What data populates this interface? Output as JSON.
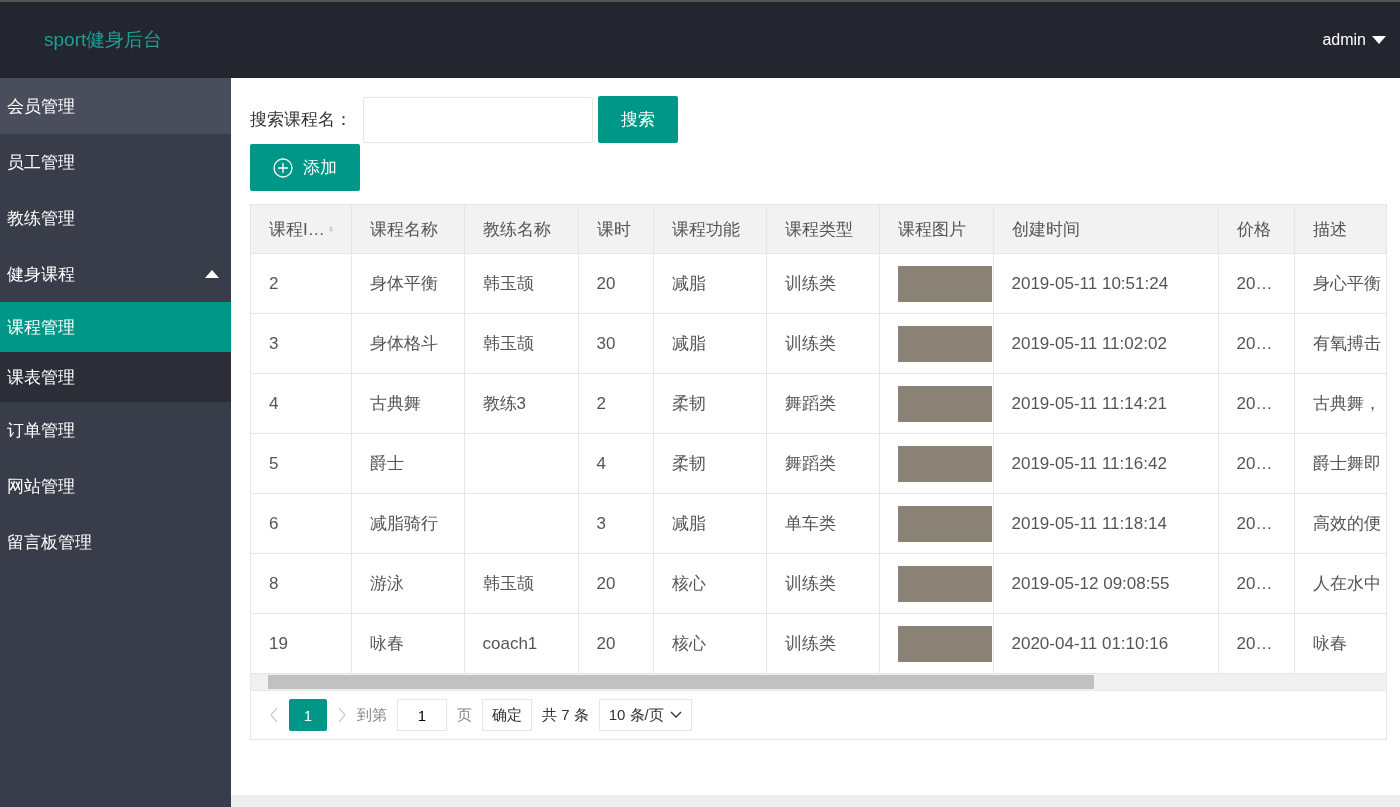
{
  "header": {
    "title": "sport健身后台",
    "user": "admin"
  },
  "sidebar": {
    "items": [
      {
        "label": "会员管理",
        "selected": false,
        "hovered": true
      },
      {
        "label": "员工管理",
        "selected": false,
        "hovered": false
      },
      {
        "label": "教练管理",
        "selected": false,
        "hovered": false
      },
      {
        "label": "健身课程",
        "selected": false,
        "hovered": false,
        "expanded": true,
        "children": [
          {
            "label": "课程管理",
            "selected": true
          },
          {
            "label": "课表管理",
            "selected": false
          }
        ]
      },
      {
        "label": "订单管理",
        "selected": false,
        "hovered": false
      },
      {
        "label": "网站管理",
        "selected": false,
        "hovered": false
      },
      {
        "label": "留言板管理",
        "selected": false,
        "hovered": false
      }
    ]
  },
  "search": {
    "label": "搜索课程名：",
    "button": "搜索"
  },
  "add_button": "添加",
  "table": {
    "columns": [
      {
        "label": "课程I…",
        "kind": "text",
        "sortable": true
      },
      {
        "label": "课程名称",
        "kind": "text"
      },
      {
        "label": "教练名称",
        "kind": "text"
      },
      {
        "label": "课时",
        "kind": "text"
      },
      {
        "label": "课程功能",
        "kind": "text"
      },
      {
        "label": "课程类型",
        "kind": "text"
      },
      {
        "label": "课程图片",
        "kind": "image"
      },
      {
        "label": "创建时间",
        "kind": "text"
      },
      {
        "label": "价格",
        "kind": "text"
      },
      {
        "label": "描述",
        "kind": "text"
      }
    ],
    "rows": [
      {
        "id": "2",
        "name": "身体平衡",
        "coach": "韩玉颉",
        "hours": "20",
        "function": "减脂",
        "type": "训练类",
        "created": "2019-05-11 10:51:24",
        "price": "20…",
        "description": "身心平衡"
      },
      {
        "id": "3",
        "name": "身体格斗",
        "coach": "韩玉颉",
        "hours": "30",
        "function": "减脂",
        "type": "训练类",
        "created": "2019-05-11 11:02:02",
        "price": "20…",
        "description": "有氧搏击"
      },
      {
        "id": "4",
        "name": "古典舞",
        "coach": "教练3",
        "hours": "2",
        "function": "柔韧",
        "type": "舞蹈类",
        "created": "2019-05-11 11:14:21",
        "price": "20…",
        "description": "古典舞，"
      },
      {
        "id": "5",
        "name": "爵士",
        "hours": "4",
        "function": "柔韧",
        "type": "舞蹈类",
        "created": "2019-05-11 11:16:42",
        "price": "20…",
        "description": "爵士舞即"
      },
      {
        "id": "6",
        "name": "减脂骑行",
        "hours": "3",
        "function": "减脂",
        "type": "单车类",
        "created": "2019-05-11 11:18:14",
        "price": "20…",
        "description": "高效的便"
      },
      {
        "id": "8",
        "name": "游泳",
        "coach": "韩玉颉",
        "hours": "20",
        "function": "核心",
        "type": "训练类",
        "created": "2019-05-12 09:08:55",
        "price": "20…",
        "description": "人在水中"
      },
      {
        "id": "19",
        "name": "咏春",
        "coach": "coach1",
        "hours": "20",
        "function": "核心",
        "type": "训练类",
        "created": "2020-04-11 01:10:16",
        "price": "20…",
        "description": "咏春"
      }
    ]
  },
  "pagination": {
    "pages": [
      {
        "label": "1",
        "selected": true
      }
    ],
    "goto_label": "到第",
    "goto_value": "1",
    "page_unit": "页",
    "confirm": "确定",
    "total": "共 7 条",
    "page_size": "10 条/页"
  }
}
